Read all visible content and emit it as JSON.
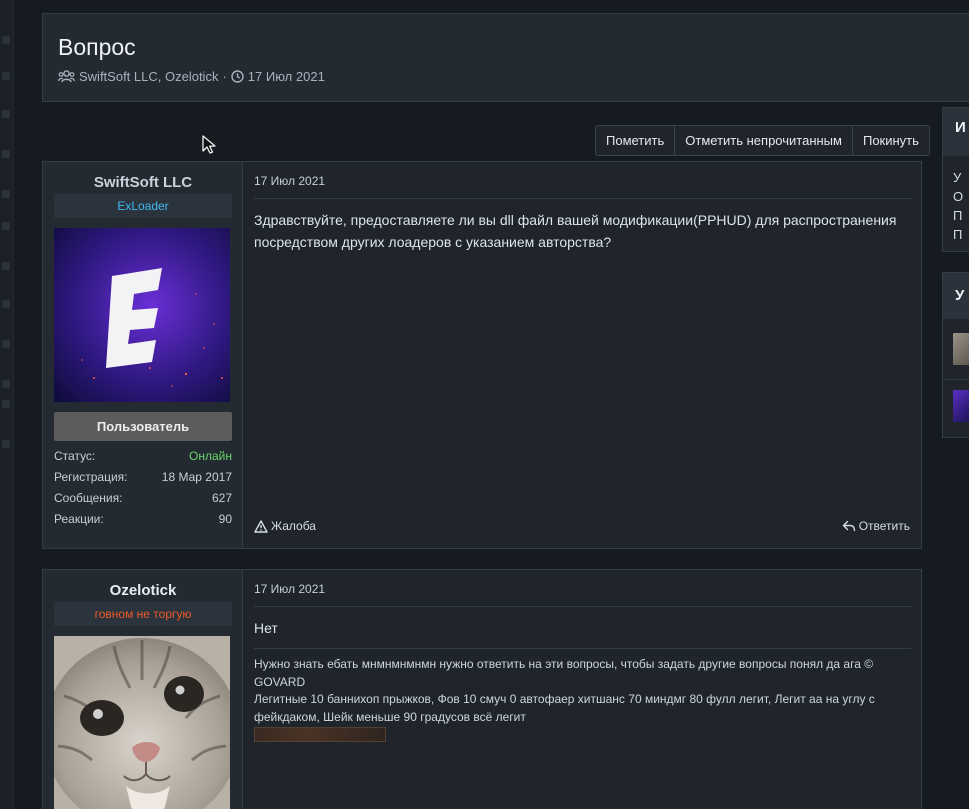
{
  "thread": {
    "title": "Вопрос",
    "participants": "SwiftSoft LLC, Ozelotick",
    "separator": "·",
    "date": "17 Июл 2021"
  },
  "actions": [
    {
      "label": "Пометить"
    },
    {
      "label": "Отметить непрочитанным"
    },
    {
      "label": "Покинуть"
    }
  ],
  "posts": [
    {
      "username": "SwiftSoft LLC",
      "user_title": "ExLoader",
      "user_title_color": "#3fb9f0",
      "role": "Пользователь",
      "stats": [
        {
          "label": "Статус:",
          "value": "Онлайн"
        },
        {
          "label": "Регистрация:",
          "value": "18 Мар 2017"
        },
        {
          "label": "Сообщения:",
          "value": "627"
        },
        {
          "label": "Реакции:",
          "value": "90"
        }
      ],
      "online_color": "#6ad46a",
      "date": "17 Июл 2021",
      "text": "Здравствуйте, предоставляете ли вы dll файл вашей модификации(PPHUD) для распространения посредством других лоадеров с указанием авторства?",
      "report_label": "Жалоба",
      "reply_label": "Ответить"
    },
    {
      "username": "Ozelotick",
      "user_title": "говном не торгую",
      "user_title_color": "#f05a28",
      "date": "17 Июл 2021",
      "text": "Нет",
      "signature": [
        "Нужно знать ебать мнмнмнмнмн нужно ответить на эти вопросы, чтобы задать другие вопросы понял да ага © GOVARD",
        "Легитные 10 баннихоп прыжков, Фов 10 смуч 0 автофаер хитшанс 70 миндмг 80 фулл легит, Легит аа на углу с фейкдаком, Шейк меньше 90 градусов всё легит"
      ]
    }
  ],
  "sidebar": {
    "block1_heading": "И",
    "block1_lines": [
      "У",
      "О",
      "П",
      "П"
    ],
    "block2_heading": "У"
  },
  "colors": {
    "accent_avatar": "#6a2fd6"
  }
}
